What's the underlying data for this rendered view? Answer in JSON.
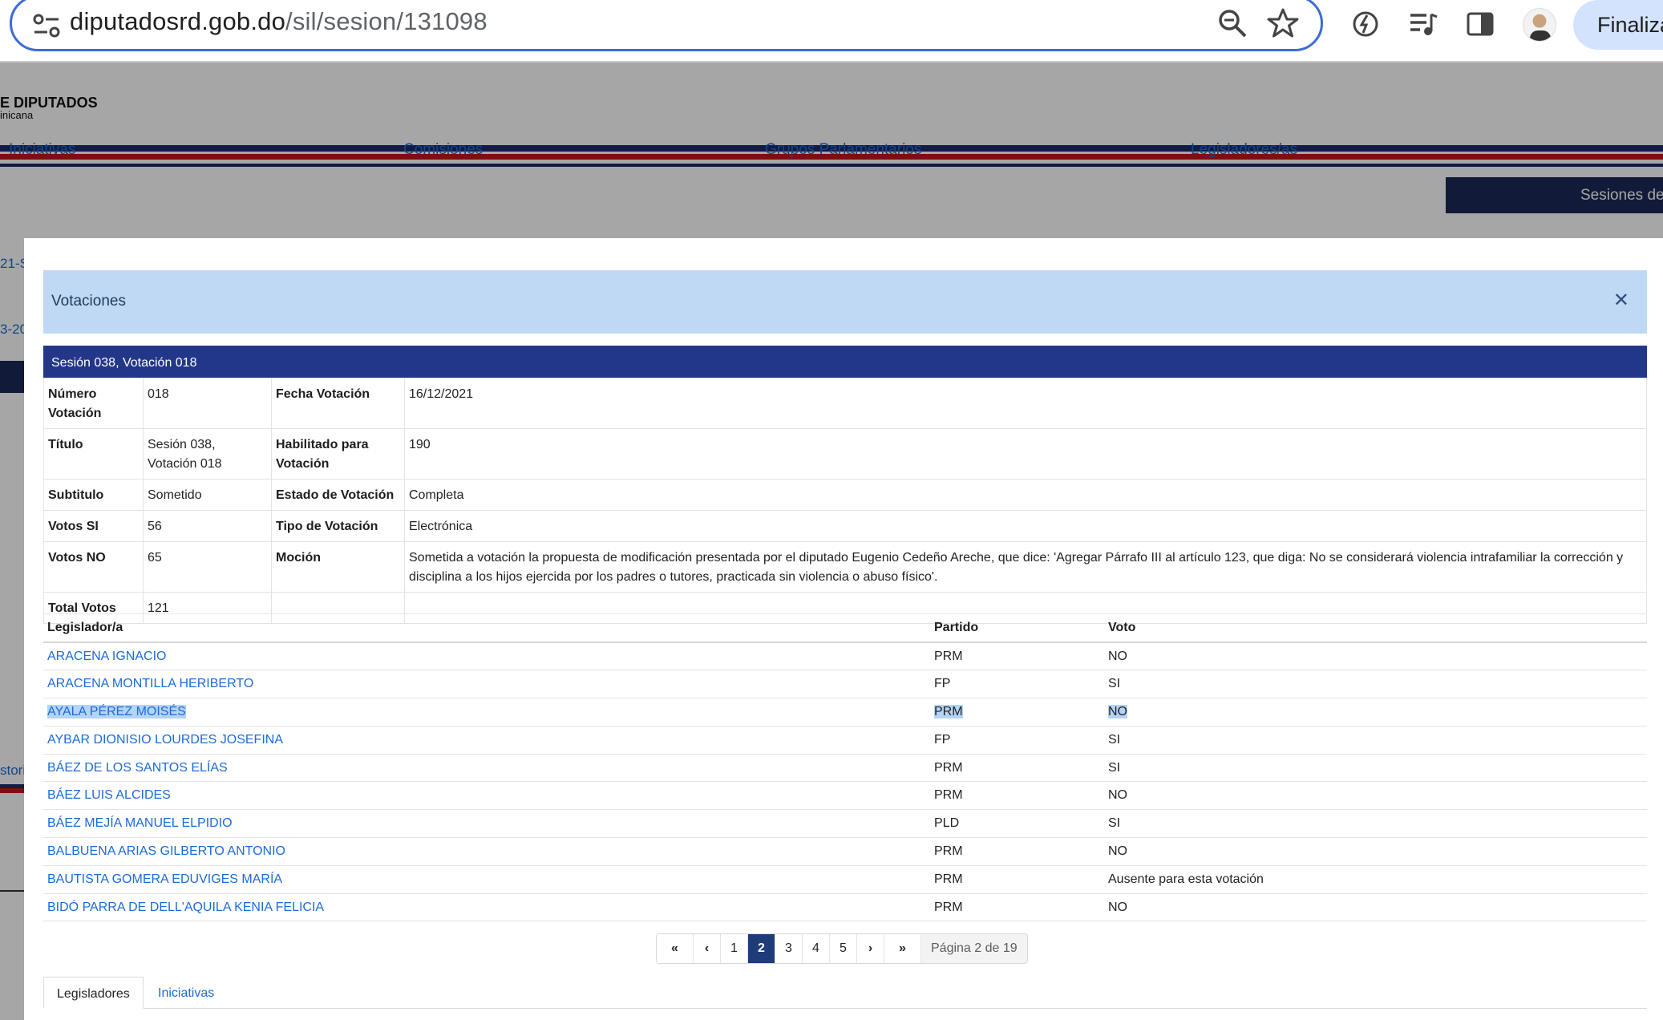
{
  "browser": {
    "url_host": "diputadosrd.gob.do",
    "url_path": "/sil/sesion/131098",
    "finalize_label": "Finaliza"
  },
  "site": {
    "logo_line1": "E DIPUTADOS",
    "logo_line2": "inicana",
    "nav": [
      "Iniciativas",
      "Comisiones",
      "Grupos Parlamentarios",
      "Legisladores/as",
      "Sesiones de"
    ],
    "side_fragments": [
      "21-S",
      "3-20",
      "stori"
    ]
  },
  "modal": {
    "title": "Votaciones",
    "vote_header": "Sesión 038, Votación 018",
    "details": {
      "numero_label": "Número Votación",
      "numero": "018",
      "fecha_label": "Fecha Votación",
      "fecha": "16/12/2021",
      "titulo_label": "Título",
      "titulo": "Sesión 038, Votación 018",
      "habilitado_label": "Habilitado para Votación",
      "habilitado": "190",
      "subtitulo_label": "Subtitulo",
      "subtitulo": "Sometido",
      "estado_label": "Estado de Votación",
      "estado": "Completa",
      "votos_si_label": "Votos SI",
      "votos_si": "56",
      "tipo_label": "Tipo de Votación",
      "tipo": "Electrónica",
      "votos_no_label": "Votos NO",
      "votos_no": "65",
      "mocion_label": "Moción",
      "mocion": "Sometida a votación la propuesta de modificación presentada por el diputado Eugenio Cedeño Areche, que dice: 'Agregar Párrafo III al artículo 123, que diga: No se considerará violencia intrafamiliar la corrección y disciplina a los hijos ejercida por los padres o tutores, practicada sin violencia o abuso físico'.",
      "total_label": "Total Votos",
      "total": "121"
    },
    "legislators": {
      "headers": [
        "Legislador/a",
        "Partido",
        "Voto"
      ],
      "rows": [
        {
          "name": "ARACENA IGNACIO",
          "party": "PRM",
          "vote": "NO"
        },
        {
          "name": "ARACENA MONTILLA HERIBERTO",
          "party": "FP",
          "vote": "SI"
        },
        {
          "name": "AYALA PÉREZ MOISÉS",
          "party": "PRM",
          "vote": "NO"
        },
        {
          "name": "AYBAR DIONISIO LOURDES JOSEFINA",
          "party": "FP",
          "vote": "SI"
        },
        {
          "name": "BÁEZ DE LOS SANTOS ELÍAS",
          "party": "PRM",
          "vote": "SI"
        },
        {
          "name": "BÁEZ LUIS ALCIDES",
          "party": "PRM",
          "vote": "NO"
        },
        {
          "name": "BÁEZ MEJÍA MANUEL ELPIDIO",
          "party": "PLD",
          "vote": "SI"
        },
        {
          "name": "BALBUENA ARIAS GILBERTO ANTONIO",
          "party": "PRM",
          "vote": "NO"
        },
        {
          "name": "BAUTISTA GOMERA EDUVIGES MARÍA",
          "party": "PRM",
          "vote": "Ausente para esta votación"
        },
        {
          "name": "BIDÓ PARRA DE DELL'AQUILA KENIA FELICIA",
          "party": "PRM",
          "vote": "NO"
        }
      ]
    },
    "pagination": {
      "first": "«",
      "prev": "‹",
      "pages": [
        "1",
        "2",
        "3",
        "4",
        "5"
      ],
      "current": "2",
      "next": "›",
      "last": "»",
      "info": "Página 2 de 19"
    },
    "tabs": [
      "Legisladores",
      "Iniciativas"
    ]
  }
}
